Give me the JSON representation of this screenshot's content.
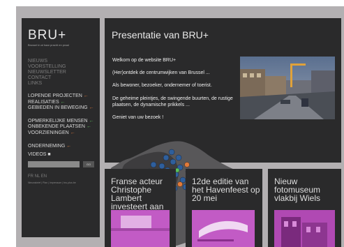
{
  "sidebar": {
    "logo": "BRU+",
    "tagline": "Brussel in al haar pracht en praal",
    "nav": [
      "Nieuws",
      "Voorstelling",
      "Nieuwsletter",
      "Contact",
      "Links"
    ],
    "group1": [
      "Lopende projecten",
      "Realisaties",
      "Gebieden in beweging"
    ],
    "group2": [
      "Opmerkelijke mensen",
      "Onbekende plaatsen",
      "Voorzieningen"
    ],
    "group3": [
      "Onderneming"
    ],
    "videos_label": "Videos",
    "search_placeholder": "",
    "search_button": "GO",
    "languages": "FR NL EN",
    "footer": "Nieuwsbrief | Plan | Impressum | bru-plus.be"
  },
  "main": {
    "title": "Presentatie van BRU+",
    "paragraphs": [
      "Welkom op de website BRU+",
      "(Her)ontdek de centrumwijken van Brussel ...",
      "Als bewoner, bezoeker, ondernemer of toerist.",
      "De geheime pleintjes, de swingende buurten, de rustige plaatsen, de dynamische prikkels ...",
      "Geniet van uw bezoek !"
    ]
  },
  "cards": [
    {
      "title": "Franse acteur Christophe Lambert investeert aan het kanaal"
    },
    {
      "title": "12de editie van het Havenfeest op 20 mei"
    },
    {
      "title": "Nieuw fotomuseum vlakbij Wiels"
    }
  ],
  "colors": {
    "panel": "#2a2a2b",
    "background": "#b3b0b2",
    "map_pin": "#2f5f9c",
    "accent_green": "#5bbf5b",
    "accent_orange": "#e07a3a",
    "thumb_magenta": "#c25bc5"
  },
  "icons": [
    "arrow-left-icon",
    "camera-icon",
    "map-pin-icon"
  ]
}
